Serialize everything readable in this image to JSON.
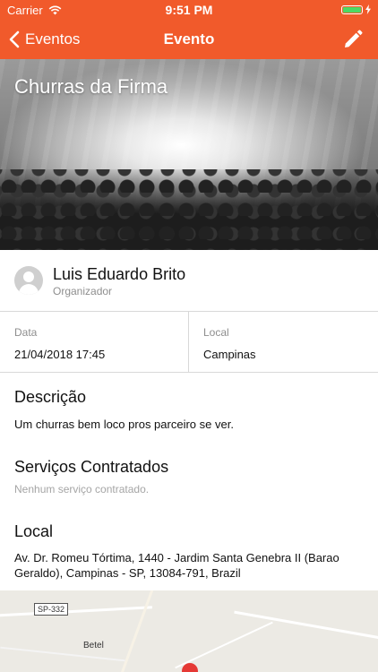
{
  "status_bar": {
    "carrier": "Carrier",
    "time": "9:51 PM"
  },
  "nav": {
    "back_label": "Eventos",
    "title": "Evento"
  },
  "event": {
    "title": "Churras da Firma",
    "organizer": {
      "name": "Luis Eduardo Brito",
      "role": "Organizador"
    },
    "date_label": "Data",
    "date_value": "21/04/2018 17:45",
    "location_label": "Local",
    "location_value": "Campinas"
  },
  "description": {
    "heading": "Descrição",
    "text": "Um churras bem loco pros parceiro se ver."
  },
  "services": {
    "heading": "Serviços Contratados",
    "empty_text": "Nenhum serviço contratado."
  },
  "address": {
    "heading": "Local",
    "line1": "Av. Dr. Romeu Tórtima, 1440 - Jardim Santa Genebra II (Barao",
    "line2": "Geraldo), Campinas - SP, 13084-791, Brazil"
  },
  "map": {
    "road_shield": "SP-332",
    "place_label": "Betel"
  },
  "colors": {
    "accent": "#f15a2b",
    "battery": "#4cd964",
    "muted": "#8e8e8e"
  },
  "icons": {
    "back": "chevron-left-icon",
    "edit": "pencil-icon",
    "wifi": "wifi-icon",
    "battery": "battery-icon",
    "avatar": "user-placeholder-icon",
    "map_pin": "map-pin-icon"
  }
}
